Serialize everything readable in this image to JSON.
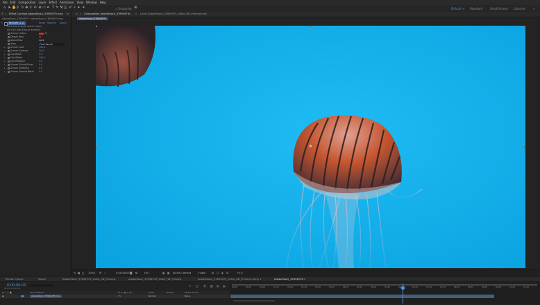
{
  "menu": [
    "File",
    "Edit",
    "Composition",
    "Layer",
    "Effect",
    "Animation",
    "View",
    "Window",
    "Help"
  ],
  "toolbar": {
    "snapping_label": "Snapping",
    "workspaces": [
      {
        "label": "Default",
        "active": true
      },
      {
        "label": "Standard",
        "active": false
      },
      {
        "label": "Small Screen",
        "active": false
      },
      {
        "label": "Libraries",
        "active": false
      }
    ]
  },
  "effect_controls": {
    "tab_label": "Effect Controls AdobeStock_37694975.mov",
    "layer_path": "AdobeStock_37694975 • AdobeStock_37694975.mov",
    "effect_name": "Keylight (1.2)",
    "effect_links": [
      "Reset",
      "Register",
      "About"
    ],
    "hint1": "Click and drag to select colors",
    "hint2": "Alt click and drag to deselect",
    "properties": [
      {
        "twirl": "",
        "label": "Screen Colour",
        "value": ""
      },
      {
        "twirl": "",
        "label": "Despill Bias",
        "value": ""
      },
      {
        "twirl": "",
        "label": "Alpha Bias",
        "value": "Lock"
      },
      {
        "twirl": "",
        "label": "View",
        "value": "Final Result"
      },
      {
        "twirl": "▸",
        "label": "Screen Gain",
        "value": "100.0"
      },
      {
        "twirl": "▸",
        "label": "Screen Balance",
        "value": "50.0"
      },
      {
        "twirl": "▸",
        "label": "Clip Black",
        "value": "0.0"
      },
      {
        "twirl": "▸",
        "label": "Clip White",
        "value": "100.0"
      },
      {
        "twirl": "▸",
        "label": "Clip Rollback",
        "value": "0.0"
      },
      {
        "twirl": "▸",
        "label": "Screen Shrink/Grow",
        "value": "0.0"
      },
      {
        "twirl": "▸",
        "label": "Screen Softness",
        "value": "0.0"
      },
      {
        "twirl": "▸",
        "label": "Screen Despot Black",
        "value": "0.0"
      }
    ],
    "screen_colour": "#d0281f"
  },
  "composition": {
    "tab_label": "Composition AdobeStock_37694975",
    "layer_tab_label": "Layer AdobeStock_37694975_Video_HD_Preview.mov",
    "breadcrumb": "AdobeStock_37694975",
    "canvas_color": "#0fb0ec"
  },
  "viewer": {
    "zoom": "100%",
    "timecode": "0:00:06:03",
    "resolution": "Full",
    "camera": "Active Camera",
    "views": "1 View",
    "exposure": "+0.0"
  },
  "timeline": {
    "tabs": [
      "Render Queue",
      "Solid1",
      "AdobeStock_37694975_Video_HD_Preview",
      "AdobeStock_37694975_Video_HD_Preview",
      "AdobeStock_37694975_Video_HD_Preview Comp 1",
      "AdobeStock_37694975"
    ],
    "timecode": "0:00:06:03",
    "frame_info": "00153 (25.00 fps)",
    "search_placeholder": "⌕",
    "col_source": "Source Name",
    "col_mode": "Mode",
    "col_trkmat": "TrkMat",
    "col_parent": "Parent & Link",
    "layer_name": "AdobeStock_37694975.mov",
    "layer_mode": "Normal",
    "layer_parent": "None",
    "ruler": [
      "00:00",
      "00:25",
      "01:00",
      "01:25",
      "02:00",
      "02:25",
      "03:00",
      "03:25",
      "04:00",
      "04:25",
      "05:00",
      "05:25",
      "06:00",
      "06:25",
      "07:00",
      "07:25",
      "08:00",
      "08:25",
      "09:00",
      "09:25",
      "10:00",
      "10:25"
    ],
    "playhead_fraction": 0.56
  }
}
